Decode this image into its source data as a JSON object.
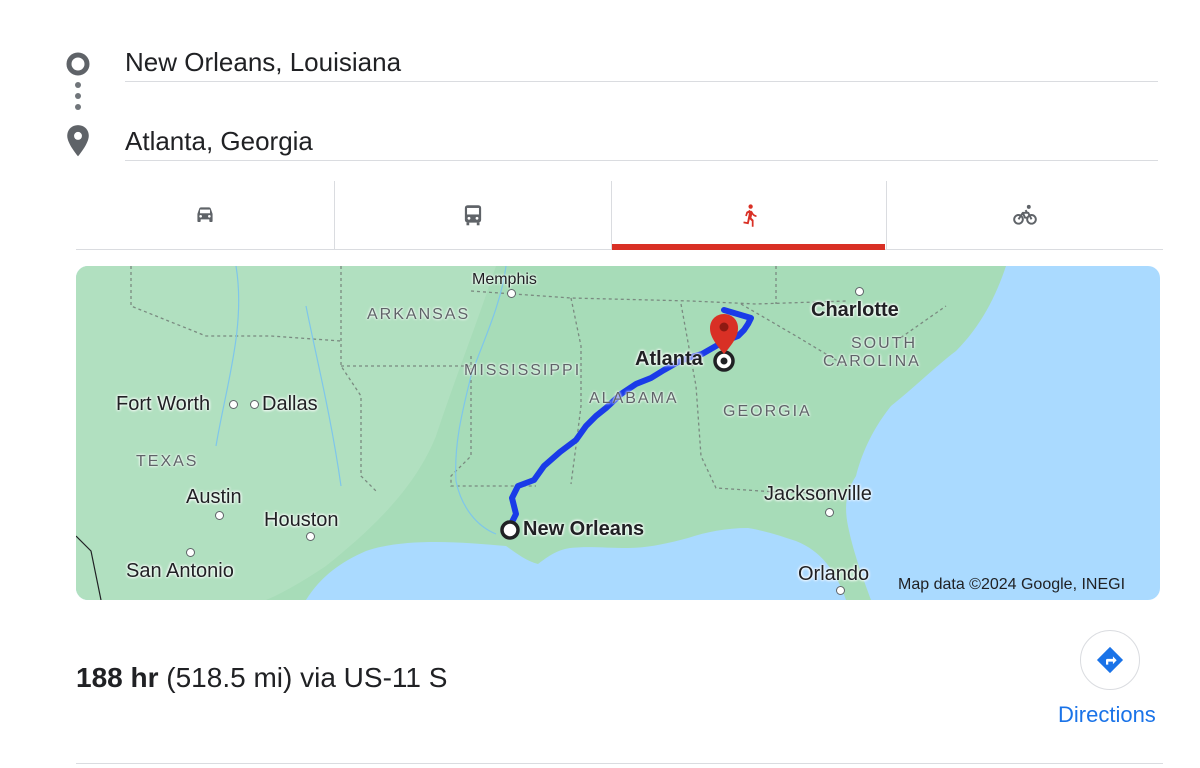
{
  "route": {
    "origin_value": "New Orleans, Louisiana",
    "destination_value": "Atlanta, Georgia"
  },
  "modes": [
    {
      "name": "driving",
      "icon": "car-icon",
      "active": false
    },
    {
      "name": "transit",
      "icon": "bus-icon",
      "active": false
    },
    {
      "name": "walking",
      "icon": "walk-icon",
      "active": true
    },
    {
      "name": "cycling",
      "icon": "bike-icon",
      "active": false
    }
  ],
  "map": {
    "labels": {
      "memphis": "Memphis",
      "arkansas": "ARKANSAS",
      "mississippi": "MISSISSIPPI",
      "alabama": "ALABAMA",
      "georgia": "GEORGIA",
      "south_carolina_1": "SOUTH",
      "south_carolina_2": "CAROLINA",
      "texas": "TEXAS",
      "charlotte": "Charlotte",
      "atlanta": "Atlanta",
      "fort_worth": "Fort Worth",
      "dallas": "Dallas",
      "austin": "Austin",
      "houston": "Houston",
      "san_antonio": "San Antonio",
      "new_orleans": "New Orleans",
      "jacksonville": "Jacksonville",
      "orlando": "Orlando"
    },
    "attribution": "Map data ©2024 Google, INEGI",
    "colors": {
      "water": "#aadaff",
      "land": "#a7dcb8",
      "route": "#1a3be8",
      "destination_pin": "#d93025"
    }
  },
  "summary": {
    "duration": "188 hr",
    "details": "(518.5 mi) via US-11 S"
  },
  "directions": {
    "label": "Directions",
    "icon": "turn-right-arrow-icon"
  }
}
